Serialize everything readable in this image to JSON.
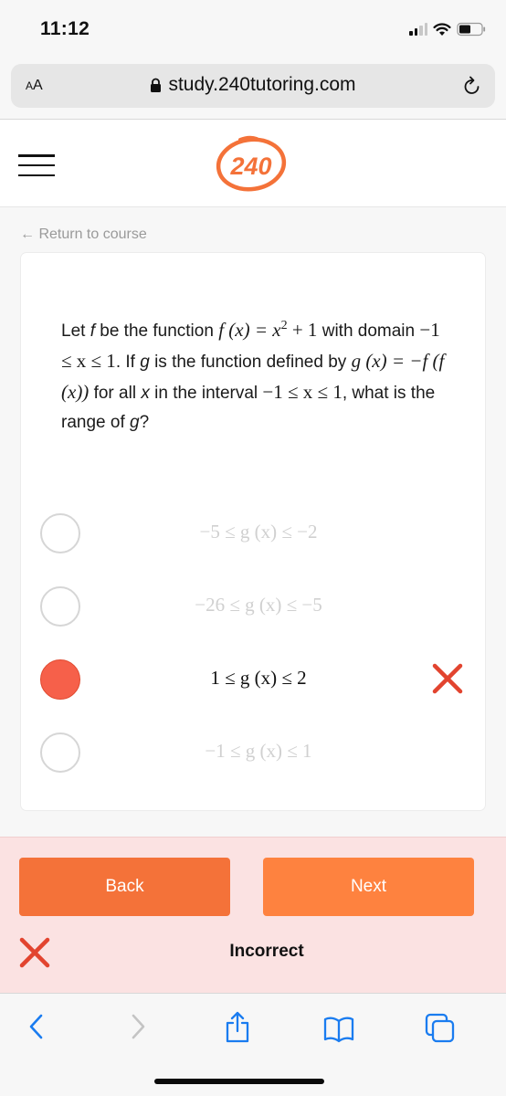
{
  "status_bar": {
    "time": "11:12",
    "icons": [
      "cellular-signal-icon",
      "wifi-icon",
      "battery-icon"
    ]
  },
  "browser": {
    "text_size_label_small": "A",
    "text_size_label_large": "A",
    "url": "study.240tutoring.com",
    "lock_icon": "lock-icon",
    "reload_icon": "reload-icon"
  },
  "header": {
    "menu_icon": "hamburger-menu-icon",
    "logo_text": "240",
    "brand_color": "#f47239"
  },
  "nav": {
    "return_link": "← Return to course"
  },
  "question": {
    "t1": "Let ",
    "f1": "f",
    "t2": " be the function ",
    "m1": "f (x) = x",
    "m1_sup": "2",
    "m1_tail": " + 1",
    "t3": " with domain ",
    "m2": "−1 ≤ x ≤ 1",
    "t4": ". If ",
    "g1": "g",
    "t5": " is the function defined by ",
    "m3": "g (x) = −f (f (x))",
    "t6": " for all ",
    "x1": "x",
    "t7": " in the interval ",
    "m4": "−1 ≤ x ≤ 1",
    "t8": ", what is the range of ",
    "g2": "g",
    "t9": "?"
  },
  "options": [
    {
      "text": "−5 ≤ g (x) ≤ −2",
      "selected": false
    },
    {
      "text": "−26 ≤ g (x) ≤ −5",
      "selected": false
    },
    {
      "text": "1 ≤ g (x) ≤ 2",
      "selected": true,
      "marked": "incorrect"
    },
    {
      "text": "−1 ≤ g (x) ≤ 1",
      "selected": false
    }
  ],
  "feedback": {
    "back_label": "Back",
    "next_label": "Next",
    "status": "Incorrect",
    "status_color": "#e2442f",
    "background": "#fbe2e2"
  },
  "toolbar": {
    "items": [
      "back-icon",
      "forward-icon",
      "share-icon",
      "bookmarks-icon",
      "tabs-icon"
    ],
    "accent": "#1a7cf0"
  }
}
